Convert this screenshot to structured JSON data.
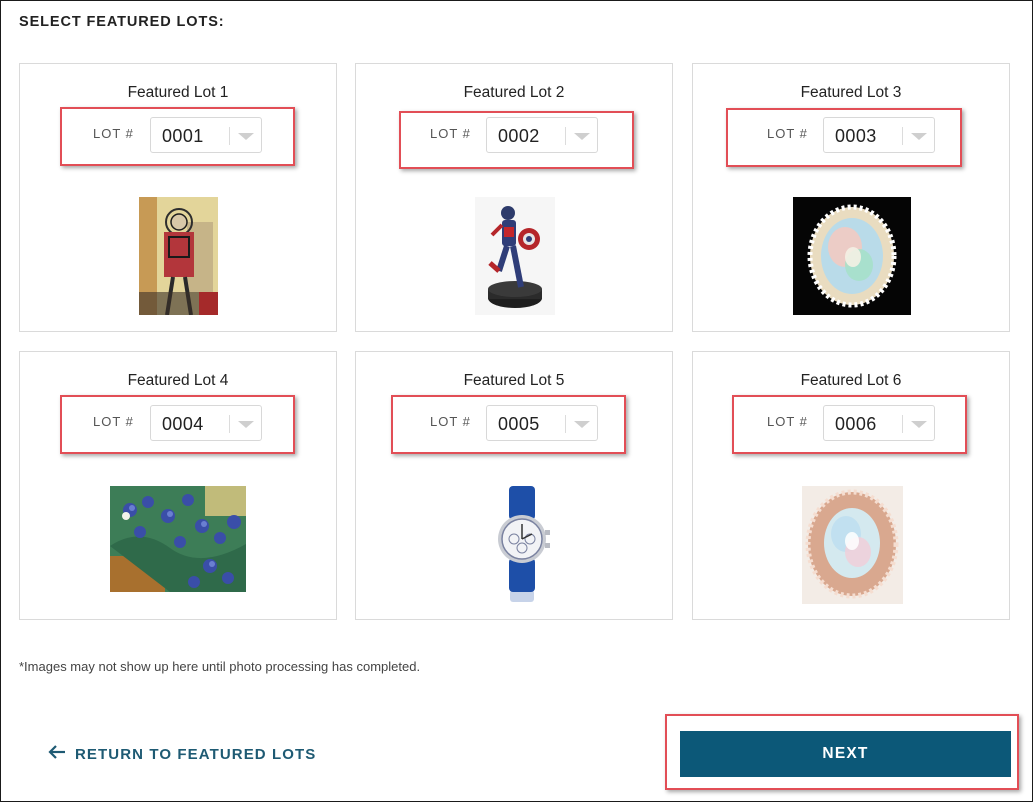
{
  "header": {
    "title": "SELECT FEATURED LOTS:"
  },
  "lots": [
    {
      "title": "Featured Lot 1",
      "lot_label": "LOT #",
      "value": "0001",
      "image": "painting-basquiat"
    },
    {
      "title": "Featured Lot 2",
      "lot_label": "LOT #",
      "value": "0002",
      "image": "superhero-figurine"
    },
    {
      "title": "Featured Lot 3",
      "lot_label": "LOT #",
      "value": "0003",
      "image": "opal-ring"
    },
    {
      "title": "Featured Lot 4",
      "lot_label": "LOT #",
      "value": "0004",
      "image": "painting-irises"
    },
    {
      "title": "Featured Lot 5",
      "lot_label": "LOT #",
      "value": "0005",
      "image": "wristwatch"
    },
    {
      "title": "Featured Lot 6",
      "lot_label": "LOT #",
      "value": "0006",
      "image": "opal-ring-rose-gold"
    }
  ],
  "footnote": "*Images may not show up here until photo processing has completed.",
  "footer": {
    "return_label": "RETURN TO FEATURED LOTS",
    "next_label": "NEXT"
  },
  "colors": {
    "accent": "#0c5878",
    "link": "#1e5a73",
    "highlight": "#e24e56"
  }
}
